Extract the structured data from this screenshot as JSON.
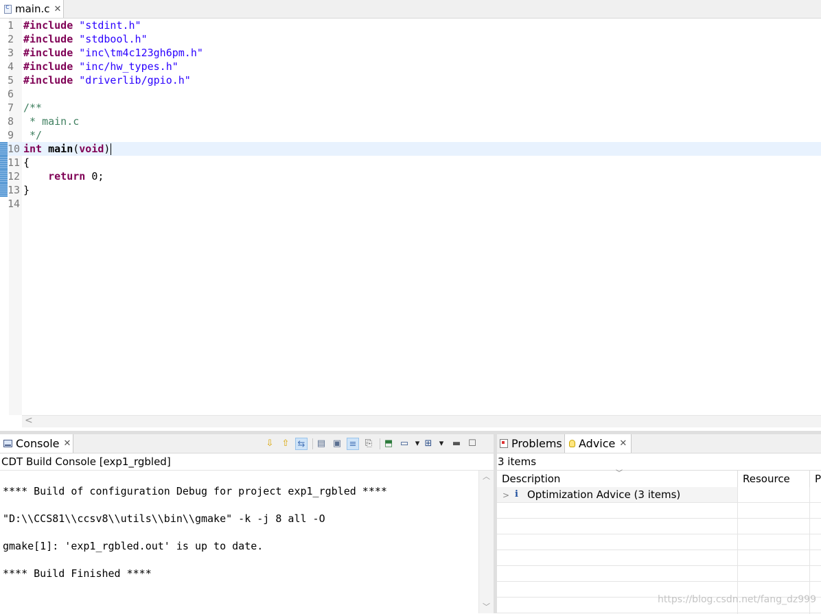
{
  "editor": {
    "tab": {
      "label": "main.c",
      "icon": "c-file-icon"
    },
    "lines": [
      {
        "n": "1",
        "tokens": [
          {
            "t": "#include",
            "c": "kw"
          },
          {
            "t": " ",
            "c": "punc"
          },
          {
            "t": "\"stdint.h\"",
            "c": "str"
          }
        ]
      },
      {
        "n": "2",
        "tokens": [
          {
            "t": "#include",
            "c": "kw"
          },
          {
            "t": " ",
            "c": "punc"
          },
          {
            "t": "\"stdbool.h\"",
            "c": "str"
          }
        ]
      },
      {
        "n": "3",
        "tokens": [
          {
            "t": "#include",
            "c": "kw"
          },
          {
            "t": " ",
            "c": "punc"
          },
          {
            "t": "\"inc\\tm4c123gh6pm.h\"",
            "c": "str"
          }
        ]
      },
      {
        "n": "4",
        "tokens": [
          {
            "t": "#include",
            "c": "kw"
          },
          {
            "t": " ",
            "c": "punc"
          },
          {
            "t": "\"inc/hw_types.h\"",
            "c": "str"
          }
        ]
      },
      {
        "n": "5",
        "tokens": [
          {
            "t": "#include",
            "c": "kw"
          },
          {
            "t": " ",
            "c": "punc"
          },
          {
            "t": "\"driverlib/gpio.h\"",
            "c": "str"
          }
        ]
      },
      {
        "n": "6",
        "tokens": []
      },
      {
        "n": "7",
        "tokens": [
          {
            "t": "/**",
            "c": "cmt"
          }
        ]
      },
      {
        "n": "8",
        "tokens": [
          {
            "t": " * main.c",
            "c": "cmt"
          }
        ]
      },
      {
        "n": "9",
        "tokens": [
          {
            "t": " */",
            "c": "cmt"
          }
        ]
      },
      {
        "n": "10",
        "current": true,
        "marker": true,
        "caret": true,
        "tokens": [
          {
            "t": "int",
            "c": "kw"
          },
          {
            "t": " ",
            "c": "punc"
          },
          {
            "t": "main",
            "c": "fn"
          },
          {
            "t": "(",
            "c": "punc"
          },
          {
            "t": "void",
            "c": "kw"
          },
          {
            "t": ")",
            "c": "punc"
          }
        ]
      },
      {
        "n": "11",
        "marker": true,
        "tokens": [
          {
            "t": "{",
            "c": "punc"
          }
        ]
      },
      {
        "n": "12",
        "marker": true,
        "tokens": [
          {
            "t": "    ",
            "c": "punc"
          },
          {
            "t": "return",
            "c": "kw"
          },
          {
            "t": " 0;",
            "c": "punc"
          }
        ]
      },
      {
        "n": "13",
        "marker": true,
        "tokens": [
          {
            "t": "}",
            "c": "punc"
          }
        ]
      },
      {
        "n": "14",
        "tokens": []
      }
    ],
    "hscroll_arrow": "<"
  },
  "console": {
    "tab": {
      "label": "Console",
      "icon": "console-icon"
    },
    "toolbar": [
      {
        "name": "scroll-down-icon",
        "glyph": "⇩",
        "color": "#d9a400"
      },
      {
        "name": "scroll-up-icon",
        "glyph": "⇧",
        "color": "#d9a400"
      },
      {
        "name": "scroll-lock-icon",
        "glyph": "⇆",
        "color": "#4a76b8",
        "selected": true
      },
      {
        "sep": true
      },
      {
        "name": "copy-build-log-icon",
        "glyph": "▤",
        "color": "#5a6f90"
      },
      {
        "name": "show-console-icon",
        "glyph": "▣",
        "color": "#5a6f90"
      },
      {
        "name": "word-wrap-icon",
        "glyph": "≡",
        "color": "#4a76b8",
        "selected": true
      },
      {
        "name": "clear-console-icon",
        "glyph": "⎘",
        "color": "#555"
      },
      {
        "sep": true
      },
      {
        "name": "pin-console-icon",
        "glyph": "⬒",
        "color": "#2c7a3a"
      },
      {
        "name": "display-console-icon",
        "glyph": "▭",
        "color": "#2c4f8a"
      },
      {
        "name": "display-console-dropdown-icon",
        "glyph": "▾",
        "color": "#222"
      },
      {
        "name": "new-console-icon",
        "glyph": "⊞",
        "color": "#2c4f8a"
      },
      {
        "name": "new-console-dropdown-icon",
        "glyph": "▾",
        "color": "#222"
      },
      {
        "name": "minimize-icon",
        "glyph": "▬",
        "color": "#555"
      },
      {
        "name": "maximize-icon",
        "glyph": "☐",
        "color": "#555"
      }
    ],
    "title": "CDT Build Console [exp1_rgbled]",
    "output": [
      "**** Build of configuration Debug for project exp1_rgbled ****",
      "\"D:\\\\CCS81\\\\ccsv8\\\\utils\\\\bin\\\\gmake\" -k -j 8 all -O",
      "gmake[1]: 'exp1_rgbled.out' is up to date.",
      "**** Build Finished ****"
    ]
  },
  "advice_view": {
    "tabs": [
      {
        "label": "Problems",
        "icon": "problems-icon"
      },
      {
        "label": "Advice",
        "icon": "lightbulb-icon"
      }
    ],
    "items_count": "3 items",
    "columns": [
      "Description",
      "Resource",
      "P"
    ],
    "rows": [
      {
        "chevron": ">",
        "icon": "i",
        "label": "Optimization Advice (3 items)"
      }
    ]
  },
  "watermark": "https://blog.csdn.net/fang_dz999"
}
